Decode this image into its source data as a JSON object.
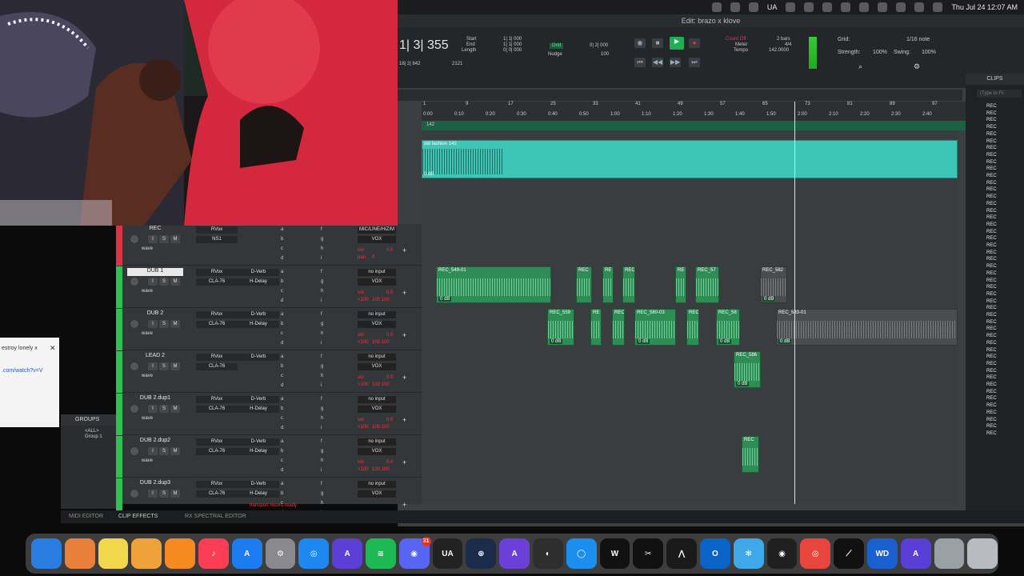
{
  "menubar": {
    "status_ua": "UA",
    "date_time": "Thu Jul 24  12:07 AM"
  },
  "window": {
    "title": "Edit: brazo x klove"
  },
  "transport": {
    "main_counter": "1| 3| 355",
    "start_label": "Start",
    "end_label": "End",
    "length_label": "Length",
    "start_val": "1| 1| 000",
    "end_val": "1| 1| 000",
    "length_val": "0| 0| 000",
    "sub_counter": "18| 2| 842",
    "sample_rate": "2121",
    "grid_label": "Grid",
    "grid_val": "0| 2| 000",
    "nudge_label": "Nudge",
    "nudge_val": "100",
    "count_off": "Count Off",
    "count_off_val": "2 bars",
    "meter": "Meter",
    "meter_val": "4/4",
    "tempo": "Tempo",
    "tempo_val": "142.0000",
    "grid2_label": "Grid:",
    "grid2_val": "1/16 note",
    "strength_label": "Strength:",
    "strength_val": "100%",
    "swing_label": "Swing:",
    "swing_val": "100%"
  },
  "ruler": {
    "bars": [
      "1",
      "9",
      "17",
      "25",
      "33",
      "41",
      "49",
      "57",
      "65",
      "73",
      "81",
      "89",
      "97"
    ],
    "times": [
      "0:00",
      "0:10",
      "0:20",
      "0:30",
      "0:40",
      "0:50",
      "1:00",
      "1:10",
      "1:20",
      "1:30",
      "1:40",
      "1:50",
      "2:00",
      "2:10",
      "2:20",
      "2:30",
      "2:40"
    ],
    "tempo_marker": "142"
  },
  "clips_panel": {
    "title": "CLIPS",
    "filter_placeholder": "(Type to Fil",
    "items": [
      "REC",
      "REC",
      "REC",
      "REC",
      "REC",
      "REC",
      "REC",
      "REC",
      "REC",
      "REC",
      "REC",
      "REC",
      "REC",
      "REC",
      "REC",
      "REC",
      "REC",
      "REC",
      "REC",
      "REC",
      "REC",
      "REC",
      "REC",
      "REC",
      "REC",
      "REC",
      "REC",
      "REC",
      "REC",
      "REC",
      "REC",
      "REC",
      "REC",
      "REC",
      "REC",
      "REC",
      "REC",
      "REC",
      "REC",
      "REC",
      "REC",
      "REC",
      "REC",
      "REC",
      "REC",
      "REC",
      "REC",
      "REC"
    ]
  },
  "old_clip": {
    "name": "old fashion 142",
    "db": "0 dB"
  },
  "tracks": [
    {
      "name": "REC",
      "ins": [
        "RVox",
        "NS1"
      ],
      "ins2": [],
      "io_top": "MIC/LINE/HIZ/M",
      "io": "VOX",
      "vol": "0.0",
      "pan": "0",
      "mode": "wave",
      "vol_label": "vol",
      "pan_label": "pan"
    },
    {
      "name": "DUB 1",
      "ins": [
        "RVox",
        "CLA-76"
      ],
      "ins2": [
        "D-Verb",
        "H-Delay"
      ],
      "io_top": "no input",
      "io": "VOX",
      "vol": "0.0",
      "pan": "100   100",
      "mode": "wave",
      "vol_label": "vol",
      "pan_label": "<100"
    },
    {
      "name": "DUB 2",
      "ins": [
        "RVox",
        "CLA-76"
      ],
      "ins2": [
        "D-Verb",
        "H-Delay"
      ],
      "io_top": "no input",
      "io": "VOX",
      "vol": "0.0",
      "pan": "100   100",
      "mode": "wave",
      "vol_label": "vol",
      "pan_label": "<100"
    },
    {
      "name": "LEAD 2",
      "ins": [
        "RVox",
        "CLA-76"
      ],
      "ins2": [
        "D-Verb"
      ],
      "io_top": "no input",
      "io": "VOX",
      "vol": "0.0",
      "pan": "100   100",
      "mode": "wave",
      "vol_label": "vol",
      "pan_label": "<100"
    },
    {
      "name": "DUB 2.dup1",
      "ins": [
        "RVox",
        "CLA-76"
      ],
      "ins2": [
        "D-Verb",
        "H-Delay"
      ],
      "io_top": "no input",
      "io": "VOX",
      "vol": "0.0",
      "pan": "100   100",
      "mode": "wave",
      "vol_label": "vol",
      "pan_label": "<100"
    },
    {
      "name": "DUB 2.dup2",
      "ins": [
        "RVox",
        "CLA-76"
      ],
      "ins2": [
        "D-Verb",
        "H-Delay"
      ],
      "io_top": "no input",
      "io": "VOX",
      "vol": "0.0",
      "pan": "100   100",
      "mode": "wave",
      "vol_label": "vol",
      "pan_label": "<100"
    },
    {
      "name": "DUB 2.dup3",
      "ins": [
        "RVox",
        "CLA-76"
      ],
      "ins2": [
        "D-Verb",
        "H-Delay"
      ],
      "io_top": "no input",
      "io": "VOX",
      "vol": "",
      "pan": "",
      "mode": "",
      "vol_label": "",
      "pan_label": ""
    }
  ],
  "send_letters": [
    "a",
    "b",
    "c",
    "d",
    "f",
    "g",
    "h",
    "i"
  ],
  "btn_labels": {
    "i": "I",
    "s": "S",
    "m": "M"
  },
  "clips": {
    "dub1": [
      {
        "name": "REC_549-01",
        "db": "0 dB"
      },
      {
        "name": "REC",
        "db": ""
      },
      {
        "name": "RE",
        "db": ""
      },
      {
        "name": "REC",
        "db": ""
      },
      {
        "name": "RE",
        "db": ""
      },
      {
        "name": "REC_57",
        "db": ""
      },
      {
        "name": "REC_582",
        "db": "0 dB"
      }
    ],
    "dub2": [
      {
        "name": "REC_559",
        "db": "0 dB"
      },
      {
        "name": "RE",
        "db": ""
      },
      {
        "name": "REC",
        "db": ""
      },
      {
        "name": "REC_580-03",
        "db": "0 dB"
      },
      {
        "name": "REC",
        "db": ""
      },
      {
        "name": "REC_58",
        "db": "0 dB"
      },
      {
        "name": "REC_583-01",
        "db": "0 dB"
      }
    ],
    "lead2": [
      {
        "name": "REC_586",
        "db": "0 dB"
      }
    ],
    "dup2": [
      {
        "name": "REC",
        "db": ""
      }
    ]
  },
  "groups": {
    "title": "GROUPS",
    "all": "<ALL>",
    "g1": "Group 1"
  },
  "bottom": {
    "midi": "MIDI EDITOR",
    "clip_effects": "CLIP EFFECTS",
    "rx": "RX SPECTRAL EDITOR",
    "status": "transport record ready"
  },
  "browser": {
    "tab_text": "estroy lonely x",
    "url_text": ".com/watch?v=V"
  },
  "dock_apps": [
    {
      "icon": "finder-icon",
      "color": "#2a7de1",
      "label": ""
    },
    {
      "icon": "launchpad-icon",
      "color": "#e87f3a",
      "label": ""
    },
    {
      "icon": "notes-icon",
      "color": "#f2d64c",
      "label": ""
    },
    {
      "icon": "photos-icon",
      "color": "#f0a23a",
      "label": ""
    },
    {
      "icon": "pages-icon",
      "color": "#f48a20",
      "label": ""
    },
    {
      "icon": "music-icon",
      "color": "#fa3e56",
      "label": "♪"
    },
    {
      "icon": "appstore-icon",
      "color": "#1d7cf2",
      "label": "A"
    },
    {
      "icon": "settings-icon",
      "color": "#8a8a8e",
      "label": "⚙"
    },
    {
      "icon": "safari-icon",
      "color": "#1e88f0",
      "label": "◎"
    },
    {
      "icon": "protools-icon",
      "color": "#5b3fd6",
      "label": "A"
    },
    {
      "icon": "spotify-icon",
      "color": "#1db954",
      "label": "≋"
    },
    {
      "icon": "discord-icon",
      "color": "#5865f2",
      "label": "◉",
      "badge": "31"
    },
    {
      "icon": "ua-connect-icon",
      "color": "#222",
      "label": "UA"
    },
    {
      "icon": "uad-icon",
      "color": "#1b2c4a",
      "label": "⊕"
    },
    {
      "icon": "protools2-icon",
      "color": "#6a40d8",
      "label": "A"
    },
    {
      "icon": "ilok-icon",
      "color": "#2e2e2e",
      "label": "◐"
    },
    {
      "icon": "xtool-icon",
      "color": "#1c8ef0",
      "label": "◯"
    },
    {
      "icon": "waves-icon",
      "color": "#111",
      "label": "W"
    },
    {
      "icon": "capcut-icon",
      "color": "#111",
      "label": "✂"
    },
    {
      "icon": "avid-icon",
      "color": "#1a1a1a",
      "label": "⋀"
    },
    {
      "icon": "outlook-icon",
      "color": "#0a64c8",
      "label": "O"
    },
    {
      "icon": "network-icon",
      "color": "#3ea8e8",
      "label": "✻"
    },
    {
      "icon": "obs-icon",
      "color": "#202020",
      "label": "◉"
    },
    {
      "icon": "chrome-icon",
      "color": "#e8453c",
      "label": "◎"
    },
    {
      "icon": "capcut2-icon",
      "color": "#111",
      "label": "⟋"
    },
    {
      "icon": "wd-icon",
      "color": "#1a5fd0",
      "label": "WD"
    },
    {
      "icon": "protools3-icon",
      "color": "#5a3fd6",
      "label": "A"
    },
    {
      "icon": "preview-icon",
      "color": "#9aa0a6",
      "label": ""
    },
    {
      "icon": "trash-icon",
      "color": "#b8bcc0",
      "label": ""
    }
  ],
  "colors": {
    "track_green": "#31c150",
    "clip_green": "#2e8c55",
    "old_clip": "#3fc5b6"
  }
}
